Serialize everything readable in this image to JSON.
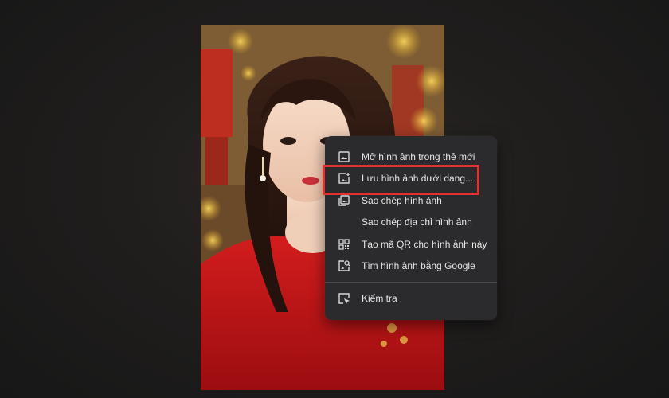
{
  "context_menu": {
    "items": [
      {
        "label": "Mở hình ảnh trong thẻ mới",
        "icon": "open-image-new-tab-icon"
      },
      {
        "label": "Lưu hình ảnh dưới dạng...",
        "icon": "save-image-icon"
      },
      {
        "label": "Sao chép hình ảnh",
        "icon": "copy-image-icon"
      },
      {
        "label": "Sao chép địa chỉ hình ảnh",
        "icon": ""
      },
      {
        "label": "Tạo mã QR cho hình ảnh này",
        "icon": "qr-code-icon"
      },
      {
        "label": "Tìm hình ảnh bằng Google",
        "icon": "image-search-icon"
      },
      {
        "label": "Kiểm tra",
        "icon": "inspect-icon"
      }
    ]
  },
  "highlight": {
    "target": "Lưu hình ảnh dưới dạng...",
    "color": "#e0322f"
  },
  "colors": {
    "menu_background": "#2b2b2d",
    "menu_text": "#e6e6e6",
    "page_background": "#1b1b1b"
  }
}
